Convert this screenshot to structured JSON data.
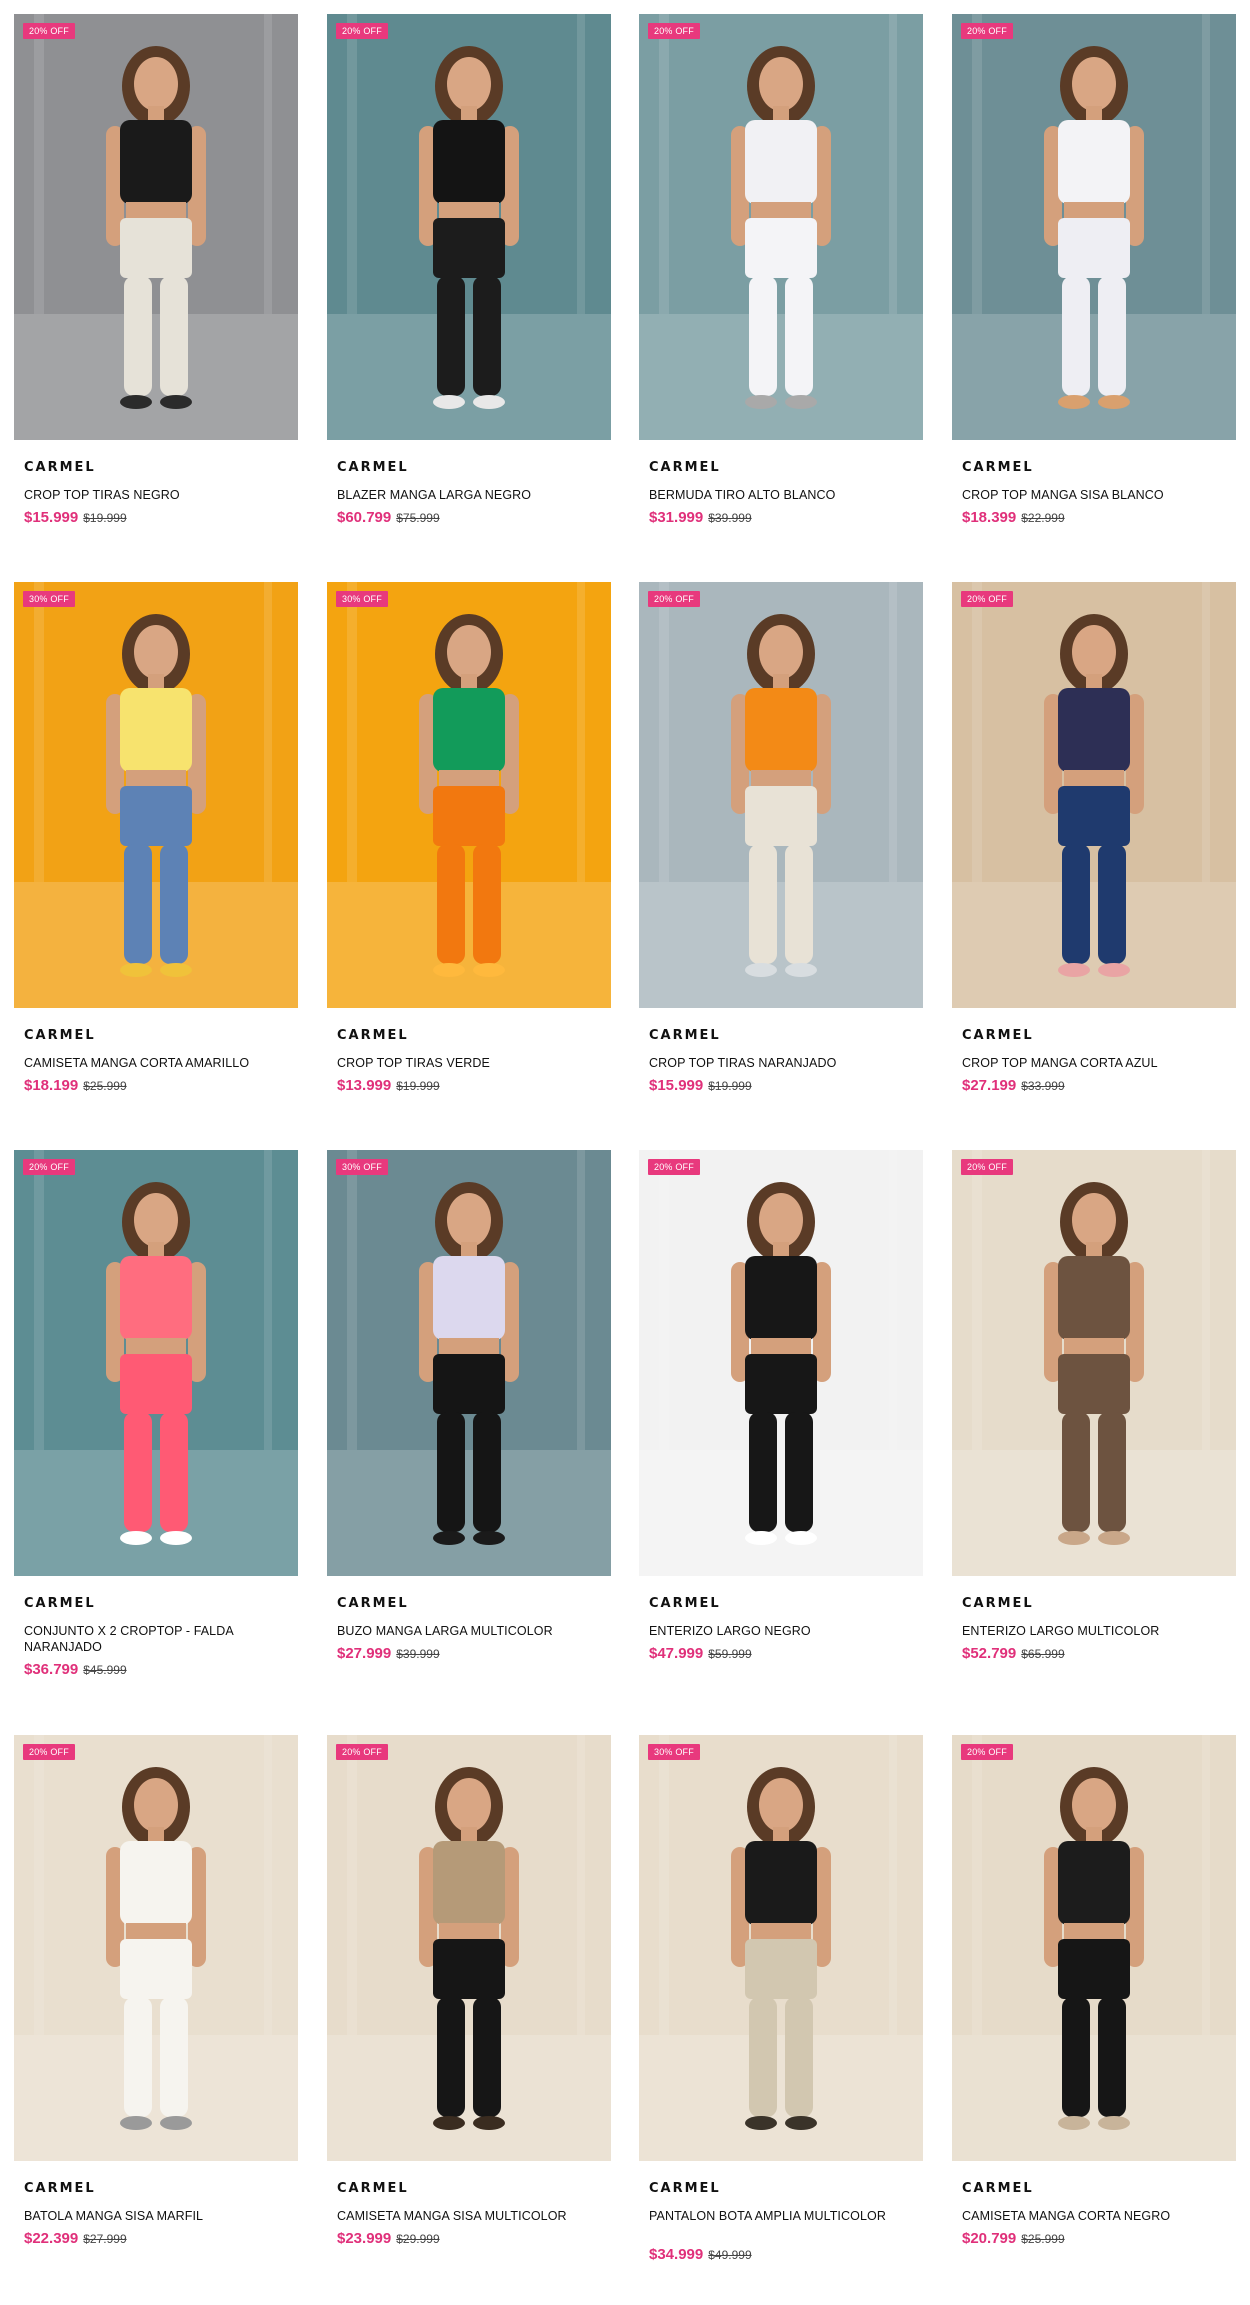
{
  "products": [
    {
      "badge": "20% OFF",
      "brand": "CARMEL",
      "name": "CROP TOP TIRAS NEGRO",
      "price": "$15.999",
      "old_price": "$19.999",
      "bg": "#8f9093",
      "top": "#1a1a1a",
      "bottom": "#e6e2d8",
      "accent": "#2b2b2b"
    },
    {
      "badge": "20% OFF",
      "brand": "CARMEL",
      "name": "BLAZER MANGA LARGA NEGRO",
      "price": "$60.799",
      "old_price": "$75.999",
      "bg": "#5f8a90",
      "top": "#141414",
      "bottom": "#1c1c1c",
      "accent": "#e8e8e8"
    },
    {
      "badge": "20% OFF",
      "brand": "CARMEL",
      "name": "BERMUDA TIRO ALTO BLANCO",
      "price": "$31.999",
      "old_price": "$39.999",
      "bg": "#7b9ea3",
      "top": "#f1f1f4",
      "bottom": "#f4f4f7",
      "accent": "#a9a9a9"
    },
    {
      "badge": "20% OFF",
      "brand": "CARMEL",
      "name": "CROP TOP MANGA SISA BLANCO",
      "price": "$18.399",
      "old_price": "$22.999",
      "bg": "#6e8f96",
      "top": "#f3f3f6",
      "bottom": "#eeeef3",
      "accent": "#d9a06e"
    },
    {
      "badge": "30% OFF",
      "brand": "CARMEL",
      "name": "CAMISETA MANGA CORTA AMARILLO",
      "price": "$18.199",
      "old_price": "$25.999",
      "bg": "#f2a215",
      "top": "#f7e36e",
      "bottom": "#5d82b5",
      "accent": "#f0c23a"
    },
    {
      "badge": "30% OFF",
      "brand": "CARMEL",
      "name": "CROP TOP TIRAS VERDE",
      "price": "$13.999",
      "old_price": "$19.999",
      "bg": "#f4a410",
      "top": "#129b5a",
      "bottom": "#f2780f",
      "accent": "#ffb93d"
    },
    {
      "badge": "20% OFF",
      "brand": "CARMEL",
      "name": "CROP TOP TIRAS NARANJADO",
      "price": "$15.999",
      "old_price": "$19.999",
      "bg": "#aab7bd",
      "top": "#f38a16",
      "bottom": "#e8e2d6",
      "accent": "#d8dde0"
    },
    {
      "badge": "20% OFF",
      "brand": "CARMEL",
      "name": "CROP TOP MANGA CORTA AZUL",
      "price": "$27.199",
      "old_price": "$33.999",
      "bg": "#d7c0a2",
      "top": "#2d2f55",
      "bottom": "#1f3a6e",
      "accent": "#e9a4a4"
    },
    {
      "badge": "20% OFF",
      "brand": "CARMEL",
      "name": "CONJUNTO X 2 CROPTOP - FALDA NARANJADO",
      "price": "$36.799",
      "old_price": "$45.999",
      "bg": "#5d8d93",
      "top": "#ff6d7f",
      "bottom": "#ff5a74",
      "accent": "#ffffff"
    },
    {
      "badge": "30% OFF",
      "brand": "CARMEL",
      "name": "BUZO MANGA LARGA MULTICOLOR",
      "price": "$27.999",
      "old_price": "$39.999",
      "bg": "#6b8a92",
      "top": "#dcd8ee",
      "bottom": "#151515",
      "accent": "#1a1a1a"
    },
    {
      "badge": "20% OFF",
      "brand": "CARMEL",
      "name": "ENTERIZO LARGO NEGRO",
      "price": "$47.999",
      "old_price": "$59.999",
      "bg": "#f2f2f2",
      "top": "#171717",
      "bottom": "#171717",
      "accent": "#ffffff"
    },
    {
      "badge": "20% OFF",
      "brand": "CARMEL",
      "name": "ENTERIZO LARGO MULTICOLOR",
      "price": "$52.799",
      "old_price": "$65.999",
      "bg": "#e6dccb",
      "top": "#6d5340",
      "bottom": "#6d5340",
      "accent": "#c9a789"
    },
    {
      "badge": "20% OFF",
      "brand": "CARMEL",
      "name": "BATOLA MANGA SISA MARFIL",
      "price": "$22.399",
      "old_price": "$27.999",
      "bg": "#e9dfcf",
      "top": "#f6f4ef",
      "bottom": "#f6f4ef",
      "accent": "#9a9a9a"
    },
    {
      "badge": "20% OFF",
      "brand": "CARMEL",
      "name": "CAMISETA MANGA SISA MULTICOLOR",
      "price": "$23.999",
      "old_price": "$29.999",
      "bg": "#e7dccb",
      "top": "#b59a78",
      "bottom": "#161616",
      "accent": "#3a2c20"
    },
    {
      "badge": "30% OFF",
      "brand": "CARMEL",
      "name": "PANTALON BOTA AMPLIA MULTICOLOR",
      "price": "$34.999",
      "old_price": "$49.999",
      "bg": "#e8ddcc",
      "top": "#1a1a1a",
      "bottom": "#d2c7b0",
      "accent": "#3a3329"
    },
    {
      "badge": "20% OFF",
      "brand": "CARMEL",
      "name": "CAMISETA MANGA CORTA NEGRO",
      "price": "$20.799",
      "old_price": "$25.999",
      "bg": "#e6dbc9",
      "top": "#1c1c1c",
      "bottom": "#161616",
      "accent": "#c8b49a"
    }
  ]
}
